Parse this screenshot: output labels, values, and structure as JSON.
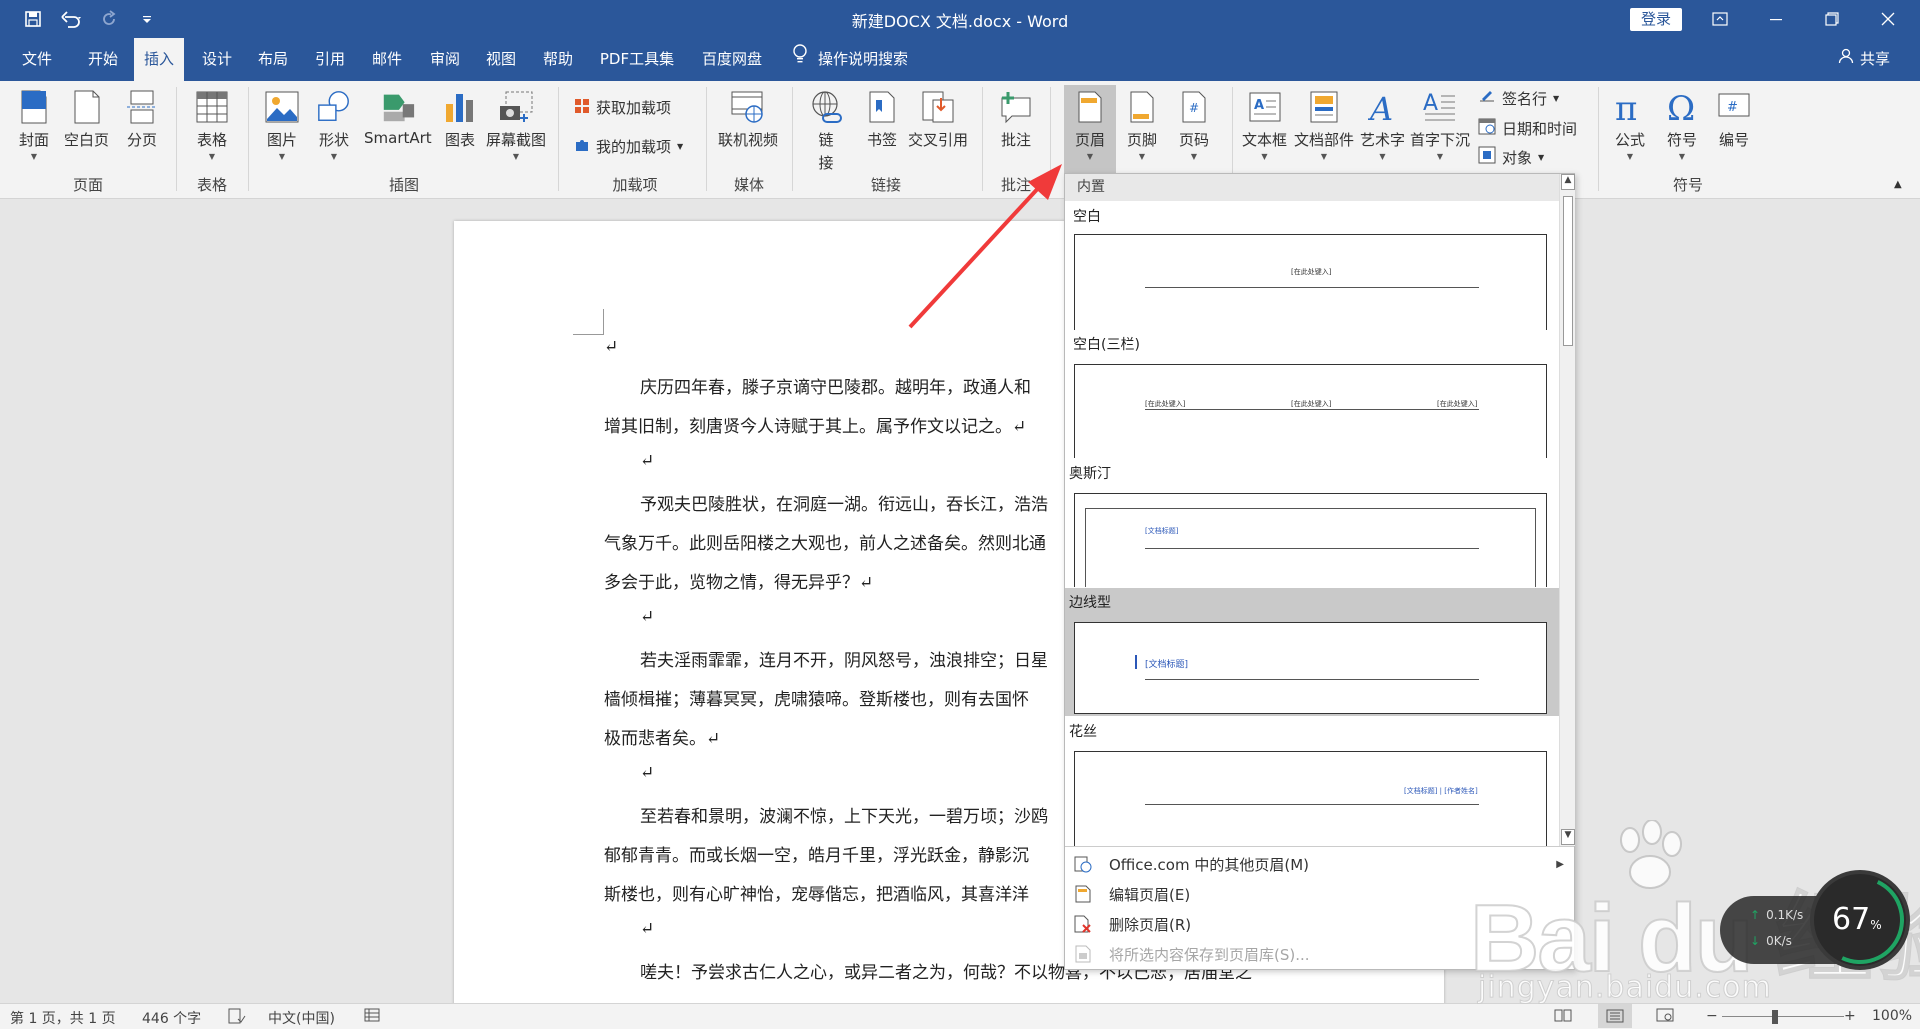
{
  "window": {
    "title": "新建DOCX 文档.docx  -  Word",
    "login_label": "登录"
  },
  "tabs": [
    {
      "label": "文件"
    },
    {
      "label": "开始"
    },
    {
      "label": "插入"
    },
    {
      "label": "设计"
    },
    {
      "label": "布局"
    },
    {
      "label": "引用"
    },
    {
      "label": "邮件"
    },
    {
      "label": "审阅"
    },
    {
      "label": "视图"
    },
    {
      "label": "帮助"
    },
    {
      "label": "PDF工具集"
    },
    {
      "label": "百度网盘"
    }
  ],
  "active_tab": "插入",
  "search_label": "操作说明搜索",
  "share_label": "共享",
  "ribbon": {
    "groups": {
      "pages": "页面",
      "tables": "表格",
      "illustrations": "插图",
      "addins": "加载项",
      "media": "媒体",
      "links": "链接",
      "comments": "批注",
      "symbols": "符号"
    },
    "buttons": {
      "cover": "封面",
      "blank_page": "空白页",
      "page_break": "分页",
      "table": "表格",
      "picture": "图片",
      "shapes": "形状",
      "smartart": "SmartArt",
      "chart": "图表",
      "screenshot": "屏幕截图",
      "get_addins": "获取加载项",
      "my_addins": "我的加载项",
      "online_video": "联机视频",
      "link_top": "链",
      "link_bottom": "接",
      "bookmark": "书签",
      "cross_ref": "交叉引用",
      "comment": "批注",
      "header": "页眉",
      "footer": "页脚",
      "page_number": "页码",
      "textbox": "文本框",
      "quick_parts": "文档部件",
      "wordart": "艺术字",
      "dropcap": "首字下沉",
      "signature_line": "签名行",
      "date_time": "日期和时间",
      "object": "对象",
      "equation": "公式",
      "symbol": "符号",
      "numbering": "编号"
    }
  },
  "document": {
    "lines": [
      {
        "text": "↵",
        "indent": false
      },
      {
        "text": "庆历四年春，滕子京谪守巴陵郡。越明年，政通人和",
        "indent": true
      },
      {
        "text": "增其旧制，刻唐贤今人诗赋于其上。属予作文以记之。↵",
        "indent": false
      },
      {
        "text": "↵",
        "indent": true
      },
      {
        "text": "予观夫巴陵胜状，在洞庭一湖。衔远山，吞长江，浩浩",
        "indent": true
      },
      {
        "text": "气象万千。此则岳阳楼之大观也，前人之述备矣。然则北通",
        "indent": false
      },
      {
        "text": "多会于此，览物之情，得无异乎？↵",
        "indent": false
      },
      {
        "text": "↵",
        "indent": true
      },
      {
        "text": "若夫淫雨霏霏，连月不开，阴风怒号，浊浪排空；日星",
        "indent": true
      },
      {
        "text": "樯倾楫摧；薄暮冥冥，虎啸猿啼。登斯楼也，则有去国怀",
        "indent": false
      },
      {
        "text": "极而悲者矣。↵",
        "indent": false
      },
      {
        "text": "↵",
        "indent": true
      },
      {
        "text": "至若春和景明，波澜不惊，上下天光，一碧万顷；沙鸥",
        "indent": true
      },
      {
        "text": "郁郁青青。而或长烟一空，皓月千里，浮光跃金，静影沉",
        "indent": false
      },
      {
        "text": "斯楼也，则有心旷神怡，宠辱偕忘，把酒临风，其喜洋洋",
        "indent": false
      },
      {
        "text": "↵",
        "indent": true
      },
      {
        "text": "嗟夫！予尝求古仁人之心，或异二者之为，何哉？不以物喜，不以己悲；居庙堂之",
        "indent": true
      }
    ]
  },
  "gallery": {
    "section_header": "内置",
    "items": [
      {
        "name": "空白",
        "placeholders": [
          "[在此处键入]"
        ]
      },
      {
        "name": "空白(三栏)",
        "placeholders": [
          "[在此处键入]",
          "[在此处键入]",
          "[在此处键入]"
        ]
      },
      {
        "name": "奥斯汀",
        "placeholders": [
          "[文档标题]"
        ]
      },
      {
        "name": "边线型",
        "placeholders": [
          "[文档标题]"
        ]
      },
      {
        "name": "花丝",
        "placeholders": [
          "[文档标题] | [作者姓名]"
        ]
      }
    ],
    "selected_item": "边线型",
    "menu": [
      {
        "label": "Office.com 中的其他页眉(M)",
        "has_submenu": true,
        "enabled": true
      },
      {
        "label": "编辑页眉(E)",
        "has_submenu": false,
        "enabled": true
      },
      {
        "label": "删除页眉(R)",
        "has_submenu": false,
        "enabled": true
      },
      {
        "label": "将所选内容保存到页眉库(S)...",
        "has_submenu": false,
        "enabled": false
      }
    ]
  },
  "statusbar": {
    "page": "第 1 页，共 1 页",
    "words": "446 个字",
    "language": "中文(中国)",
    "zoom": "100%"
  },
  "watermark": {
    "brand": "Bai du 经验",
    "url": "jingyan.baidu.com"
  },
  "speed_widget": {
    "percent": "67",
    "percent_unit": "%",
    "up": "0.1K/s",
    "down": "0K/s"
  },
  "colors": {
    "accent": "#2b579a",
    "arrow": "#f03a3a"
  }
}
